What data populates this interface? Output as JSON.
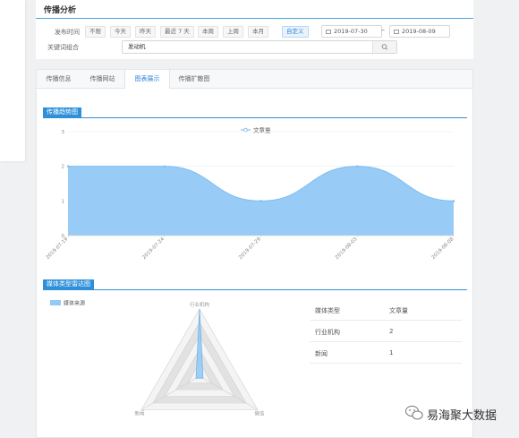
{
  "top_card": {
    "title": "传播分析",
    "publish_time_label": "发布时间",
    "time_chips": [
      "不限",
      "今天",
      "昨天",
      "最近 7 天",
      "本周",
      "上周",
      "本月",
      "自定义"
    ],
    "date_start": "2019-07-30",
    "date_sep": "–",
    "date_end": "2019-08-09",
    "keyword_label": "关键词组合",
    "keyword_value": "发动机"
  },
  "tabs": [
    "传播信息",
    "传播网站",
    "图表展示",
    "传播扩散图"
  ],
  "active_tab": "图表展示",
  "trend": {
    "section_title": "传播趋势图",
    "legend": "文章量"
  },
  "radar": {
    "section_title": "媒体类型雷达图",
    "legend": "媒体来源",
    "axes": [
      "行业机构",
      "微信",
      "新闻"
    ]
  },
  "table": {
    "headers": [
      "媒体类型",
      "文章量"
    ],
    "rows": [
      [
        "行业机构",
        "2"
      ],
      [
        "新闻",
        "1"
      ]
    ]
  },
  "watermark": "易海聚大数据",
  "colors": {
    "accent": "#2f90da",
    "area_fill": "#92c9f5",
    "active_tab_text": "#2f86d6"
  },
  "chart_data": [
    {
      "type": "area",
      "title": "传播趋势图",
      "series": [
        {
          "name": "文章量",
          "x": [
            "2019-07-19",
            "2019-07-24",
            "2019-07-29",
            "2019-08-03",
            "2019-08-08"
          ],
          "values": [
            2,
            2,
            1,
            2,
            1
          ]
        }
      ],
      "xlabels": [
        "2019-07-19",
        "2019-07-24",
        "2019-07-29",
        "2019-08-03",
        "2019-08-08"
      ],
      "yticks": [
        "0",
        "1",
        "2",
        "3"
      ],
      "ylim": [
        0,
        3
      ],
      "smooth": true,
      "legend_position": "top-center"
    },
    {
      "type": "radar",
      "title": "媒体类型雷达图",
      "categories": [
        "行业机构",
        "微信",
        "新闻"
      ],
      "series": [
        {
          "name": "媒体来源",
          "values": [
            2,
            0,
            0
          ]
        }
      ],
      "max": 2
    }
  ]
}
